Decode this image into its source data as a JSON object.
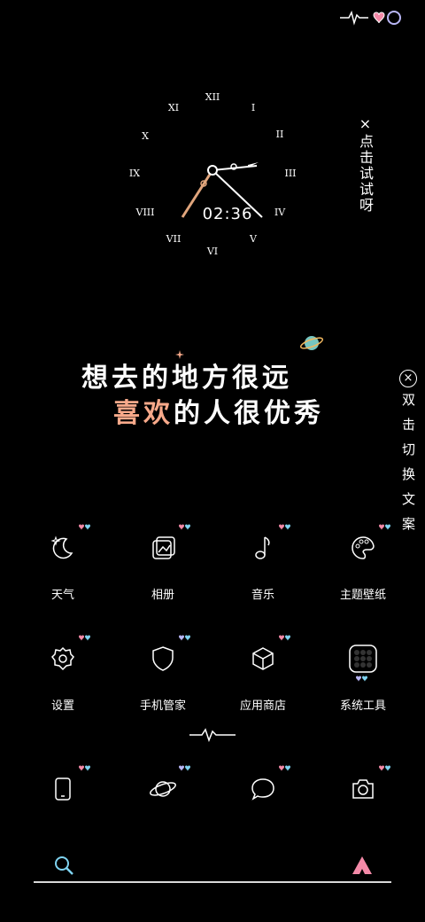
{
  "status": {
    "icons": [
      "heartbeat-icon",
      "heart-icon",
      "ring-icon"
    ]
  },
  "clock": {
    "time": "02:36"
  },
  "tap_hint": "×点击试试呀",
  "slogan": {
    "line1": "想去的地方很远",
    "line2_highlight": "喜欢",
    "line2_rest": "的人很优秀"
  },
  "side_hint": {
    "close": "×",
    "text": "双击切换文案"
  },
  "apps_row1": [
    {
      "label": "天气",
      "icon": "moon-star-icon"
    },
    {
      "label": "相册",
      "icon": "gallery-icon"
    },
    {
      "label": "音乐",
      "icon": "music-note-icon"
    },
    {
      "label": "主题壁纸",
      "icon": "palette-icon"
    }
  ],
  "apps_row2": [
    {
      "label": "设置",
      "icon": "gear-icon"
    },
    {
      "label": "手机管家",
      "icon": "shield-icon"
    },
    {
      "label": "应用商店",
      "icon": "cube-icon"
    },
    {
      "label": "系统工具",
      "icon": "folder-icon"
    }
  ],
  "dock": [
    {
      "icon": "phone-icon"
    },
    {
      "icon": "planet-icon"
    },
    {
      "icon": "message-icon"
    },
    {
      "icon": "camera-icon"
    }
  ],
  "colors": {
    "accent_pink": "#f7a98a",
    "heart_pink": "#f48aa8",
    "heart_blue": "#7fd3f0",
    "search_blue": "#7fd3f0",
    "brand_pink": "#f48aa8"
  }
}
